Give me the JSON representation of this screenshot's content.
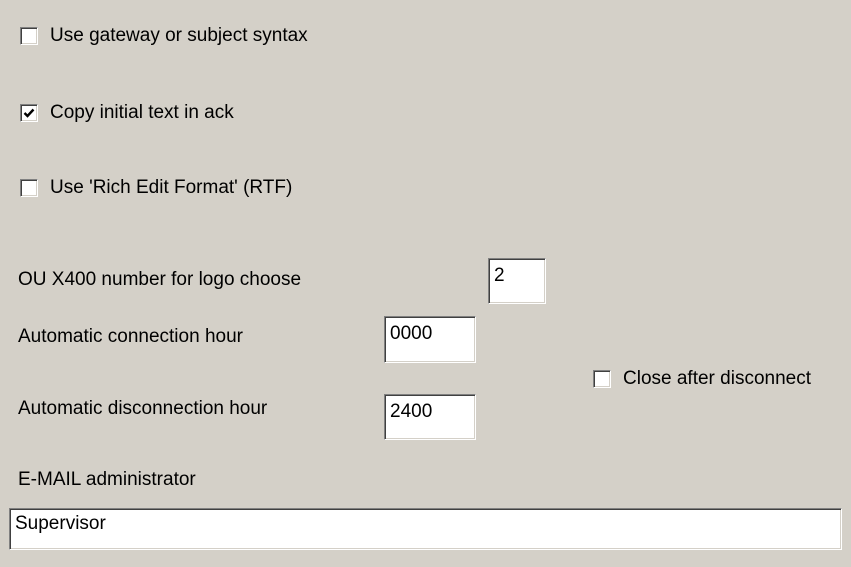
{
  "options": {
    "gateway_syntax": {
      "label": "Use gateway or subject syntax",
      "checked": false
    },
    "copy_initial_text": {
      "label": "Copy initial text in ack",
      "checked": true
    },
    "rich_edit_format": {
      "label": "Use 'Rich Edit Format' (RTF)",
      "checked": false
    }
  },
  "ou_x400": {
    "label": "OU X400 number for logo choose",
    "value": "2"
  },
  "connection_hour": {
    "label": "Automatic connection hour",
    "value": "0000"
  },
  "disconnection_hour": {
    "label": "Automatic disconnection hour",
    "value": "2400"
  },
  "close_after_disconnect": {
    "label": "Close after disconnect",
    "checked": false
  },
  "email_admin": {
    "label": "E-MAIL administrator",
    "value": "Supervisor"
  }
}
